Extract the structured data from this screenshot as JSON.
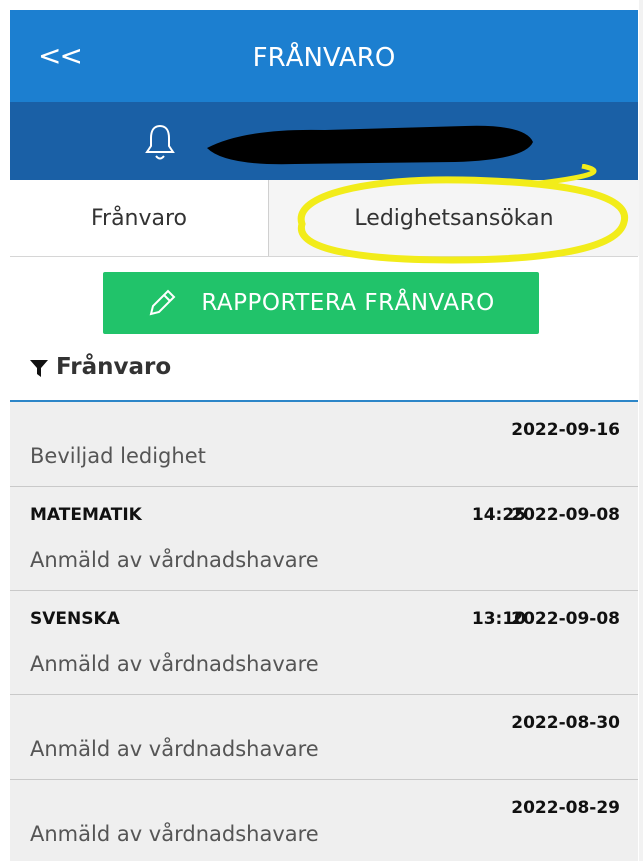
{
  "header": {
    "back_label": "<<",
    "title": "FRÅNVARO"
  },
  "user_bar": {
    "icon": "bell-icon",
    "name_redacted": true
  },
  "tabs": [
    {
      "label": "Frånvaro",
      "selected": true
    },
    {
      "label": "Ledighetsansökan",
      "selected": false,
      "highlighted": true
    }
  ],
  "report_button": {
    "icon": "pencil-icon",
    "label": "RAPPORTERA FRÅNVARO"
  },
  "filter": {
    "icon": "filter-icon",
    "label": "Frånvaro"
  },
  "absences": [
    {
      "subject": "",
      "time": "",
      "date": "2022-09-16",
      "description": "Beviljad ledighet"
    },
    {
      "subject": "MATEMATIK",
      "time": "14:25",
      "date": "2022-09-08",
      "description": "Anmäld av vårdnadshavare"
    },
    {
      "subject": "SVENSKA",
      "time": "13:10",
      "date": "2022-09-08",
      "description": "Anmäld av vårdnadshavare"
    },
    {
      "subject": "",
      "time": "",
      "date": "2022-08-30",
      "description": "Anmäld av vårdnadshavare"
    },
    {
      "subject": "",
      "time": "",
      "date": "2022-08-29",
      "description": "Anmäld av vårdnadshavare"
    }
  ],
  "colors": {
    "header_bg": "#1c7fd0",
    "user_bar_bg": "#1a60a6",
    "button_green": "#21c36a",
    "highlight_yellow": "#f2ec1a",
    "row_bg": "#efefef"
  }
}
